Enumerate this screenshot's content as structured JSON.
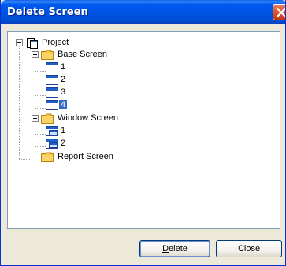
{
  "window": {
    "title": "Delete Screen"
  },
  "tree": {
    "root": {
      "label": "Project",
      "icon": "project-icon"
    },
    "base_screen": {
      "label": "Base Screen",
      "icon": "folder-icon",
      "items": [
        {
          "label": "1",
          "icon": "screen-icon"
        },
        {
          "label": "2",
          "icon": "screen-icon"
        },
        {
          "label": "3",
          "icon": "screen-icon"
        },
        {
          "label": "4",
          "icon": "screen-icon",
          "selected": true
        }
      ]
    },
    "window_screen": {
      "label": "Window Screen",
      "icon": "folder-icon",
      "items": [
        {
          "label": "1",
          "icon": "window-screen-icon"
        },
        {
          "label": "2",
          "icon": "window-screen-icon"
        }
      ]
    },
    "report_screen": {
      "label": "Report Screen",
      "icon": "folder-icon"
    }
  },
  "buttons": {
    "delete_mnemonic": "D",
    "delete_rest": "elete",
    "close_label": "Close"
  },
  "colors": {
    "title_bar": "#0054e3",
    "dialog_bg": "#ece9d8",
    "selection": "#316ac5",
    "folder": "#f5c542"
  }
}
